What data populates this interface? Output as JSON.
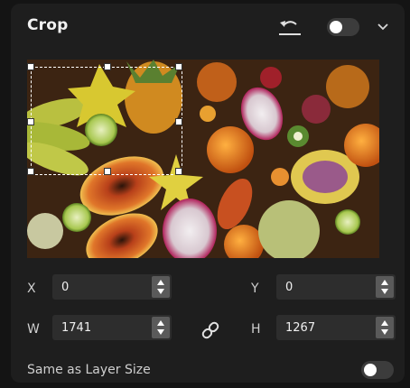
{
  "panel": {
    "title": "Crop",
    "icons": {
      "reset": "reset-undo-icon",
      "collapse": "chevron-down-icon",
      "link": "link-chain-icon"
    },
    "enabled": false
  },
  "preview": {
    "description_icon": "image-preview",
    "crop_handles": 8
  },
  "fields": {
    "x": {
      "label": "X",
      "value": "0"
    },
    "y": {
      "label": "Y",
      "value": "0"
    },
    "w": {
      "label": "W",
      "value": "1741"
    },
    "h": {
      "label": "H",
      "value": "1267"
    }
  },
  "same_as_layer": {
    "label": "Same as Layer Size",
    "enabled": false
  },
  "colors": {
    "panel_bg": "#1e1e1e",
    "field_bg": "#2d2d2d",
    "stepper_bg": "#5a5a5a",
    "toggle_track": "#3c3c3c",
    "toggle_knob": "#ffffff"
  }
}
